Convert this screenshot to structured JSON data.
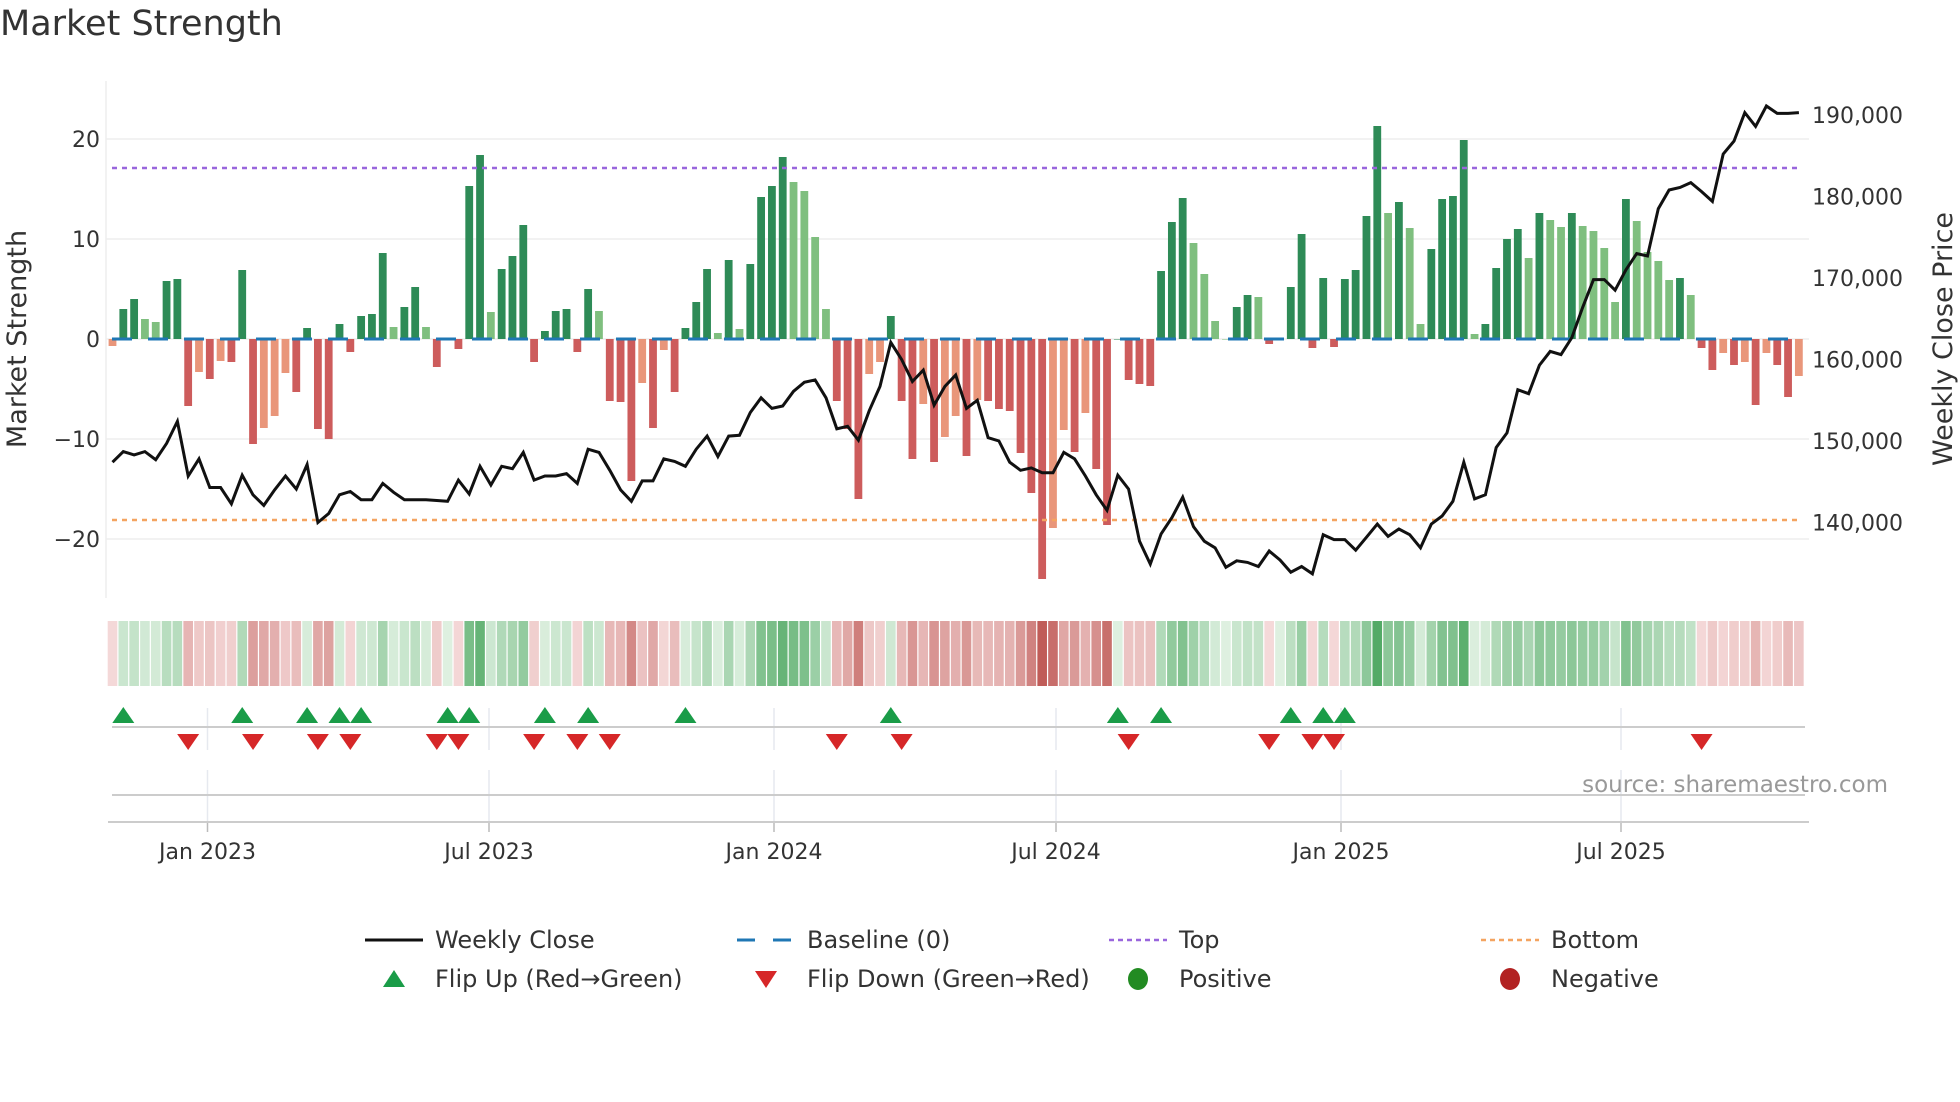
{
  "chart_data": {
    "type": "bar",
    "title": "Market Strength",
    "ylabel": "Market Strength",
    "y2label": "Weekly Close Price",
    "ylim": [
      -26,
      26
    ],
    "y2lim": [
      133000,
      192000
    ],
    "yticks": [
      20,
      10,
      0,
      -10,
      -20
    ],
    "yticklabels": [
      "20",
      "10",
      "0",
      "−10",
      "−20"
    ],
    "y2ticks": [
      190000,
      180000,
      170000,
      160000,
      150000,
      140000
    ],
    "y2ticklabels": [
      "190,000",
      "180,000",
      "170,000",
      "160,000",
      "150,000",
      "140,000"
    ],
    "xticklabels": [
      "Jan 2023",
      "Jul 2023",
      "Jan 2024",
      "Jul 2024",
      "Jan 2025",
      "Jul 2025"
    ],
    "frequency": "weekly",
    "top_level": 17.1,
    "bottom_level": -18.1,
    "baseline": 0,
    "strength": [
      -0.7,
      3,
      4,
      2,
      1.7,
      5.8,
      6,
      -6.7,
      -3.3,
      -4,
      -2.2,
      -2.3,
      6.9,
      -10.5,
      -8.9,
      -7.7,
      -3.4,
      -5.3,
      1.1,
      -9,
      -10,
      1.5,
      -1.3,
      2.3,
      2.5,
      8.6,
      1.2,
      3.2,
      5.2,
      1.2,
      -2.8,
      0,
      -1,
      15.3,
      18.4,
      2.7,
      7,
      8.3,
      11.4,
      -2.3,
      0.8,
      2.8,
      3,
      -1.3,
      5,
      2.8,
      -6.2,
      -6.3,
      -14.2,
      -4.4,
      -8.9,
      -1.1,
      -5.3,
      1.1,
      3.7,
      7,
      0.6,
      7.9,
      1,
      7.5,
      14.2,
      15.3,
      18.2,
      15.7,
      14.8,
      10.2,
      3,
      -6.2,
      -9,
      -16,
      -3.5,
      -2.3,
      2.3,
      -6.2,
      -12,
      -6.5,
      -12.3,
      -9.8,
      -7.7,
      -11.7,
      -6.1,
      -6.2,
      -7,
      -7.2,
      -11.4,
      -15.4,
      -24,
      -18.9,
      -9.1,
      -11.3,
      -7.4,
      -13,
      -18.6,
      0,
      -4.1,
      -4.5,
      -4.7,
      6.8,
      11.7,
      14.1,
      9.6,
      6.5,
      1.8,
      0,
      3.2,
      4.4,
      4.2,
      -0.5,
      0,
      5.2,
      10.5,
      -0.9,
      6.1,
      -0.8,
      6,
      6.9,
      12.3,
      21.3,
      12.6,
      13.7,
      11.1,
      1.5,
      9,
      14,
      14.3,
      19.9,
      0.5,
      1.5,
      7.1,
      10,
      11,
      8.1,
      12.6,
      11.9,
      11.2,
      12.6,
      11.3,
      10.8,
      9.1,
      3.7,
      14,
      11.8,
      8.7,
      7.8,
      5.9,
      6.1,
      4.4,
      -0.9,
      -3.1,
      -1.4,
      -2.6,
      -2.3,
      -6.6,
      -1.4,
      -2.6,
      -5.8,
      -3.7
    ],
    "weekly_close": [
      147400,
      148700,
      148300,
      148700,
      147700,
      149700,
      152400,
      145700,
      147800,
      144300,
      144300,
      142300,
      145800,
      143400,
      142100,
      144000,
      145700,
      144100,
      147100,
      140000,
      141100,
      143400,
      143800,
      142800,
      142800,
      144800,
      143700,
      142800,
      142800,
      142800,
      142700,
      142600,
      145200,
      143500,
      146900,
      144600,
      146900,
      146600,
      148600,
      145200,
      145700,
      145700,
      146000,
      144800,
      149000,
      148600,
      146400,
      144000,
      142600,
      145100,
      145100,
      147800,
      147500,
      146900,
      149000,
      150600,
      148100,
      150600,
      150700,
      153500,
      155300,
      154000,
      154300,
      156100,
      157200,
      157500,
      155300,
      151500,
      151800,
      150100,
      153700,
      156700,
      162100,
      160000,
      157300,
      158700,
      154400,
      156700,
      158100,
      154000,
      155000,
      150400,
      150000,
      147400,
      146400,
      146700,
      146100,
      146100,
      148600,
      147800,
      145700,
      143400,
      141500,
      145800,
      144100,
      137700,
      134900,
      138600,
      140600,
      143100,
      139500,
      137700,
      136900,
      134500,
      135300,
      135100,
      134600,
      136500,
      135400,
      133900,
      134600,
      133700,
      138500,
      137900,
      137900,
      136600,
      138200,
      139800,
      138300,
      139200,
      138500,
      136900,
      139800,
      140800,
      142600,
      147400,
      142900,
      143400,
      149200,
      151000,
      156300,
      155800,
      159300,
      161000,
      160600,
      162700,
      166400,
      169800,
      169800,
      168500,
      171000,
      173000,
      172700,
      178500,
      180800,
      181100,
      181700,
      180600,
      179400,
      185200,
      186800,
      190300,
      188600,
      191100,
      190200,
      190200,
      190300
    ],
    "flip_up_week_index": [
      1,
      12,
      18,
      21,
      23,
      31,
      33,
      40,
      44,
      53,
      72,
      93,
      97,
      109,
      112,
      114
    ],
    "flip_down_week_index": [
      7,
      13,
      19,
      22,
      30,
      32,
      39,
      43,
      46,
      67,
      73,
      94,
      107,
      111,
      113,
      147
    ],
    "legend": [
      {
        "label": "Weekly Close",
        "marker": "line"
      },
      {
        "label": "Baseline (0)",
        "marker": "dashed"
      },
      {
        "label": "Top",
        "marker": "dotted"
      },
      {
        "label": "Bottom",
        "marker": "dotted"
      },
      {
        "label": "Flip Up (Red→Green)",
        "marker": "triangle-up"
      },
      {
        "label": "Flip Down (Green→Red)",
        "marker": "triangle-down"
      },
      {
        "label": "Positive",
        "marker": "circle"
      },
      {
        "label": "Negative",
        "marker": "circle"
      }
    ],
    "legend_position": "bottom",
    "grid": true,
    "source": "source: sharemaestro.com",
    "colors": {
      "pos_rising": "#2e8b57",
      "pos_falling": "#7fbf7f",
      "neg_falling": "#cd5c5c",
      "neg_rising": "#e9967a",
      "line": "#111111",
      "baseline": "#1f77b4",
      "top": "#9966dd",
      "bottom": "#f4a460",
      "flip_up": "#1a9c48",
      "flip_down": "#d62728",
      "positive": "#228b22",
      "negative": "#b22222"
    }
  }
}
